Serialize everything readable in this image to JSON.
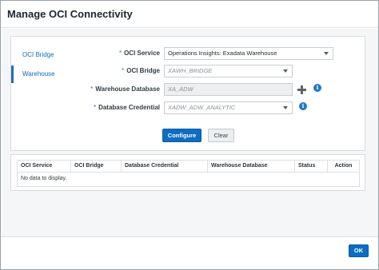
{
  "dialog": {
    "title": "Manage OCI Connectivity"
  },
  "nav": {
    "items": [
      {
        "label": "OCI Bridge"
      },
      {
        "label": "Warehouse"
      }
    ]
  },
  "form": {
    "required_mark": "*",
    "oci_service": {
      "label": "OCI Service",
      "value": "Operations Insights: Exadata Warehouse"
    },
    "oci_bridge": {
      "label": "OCI Bridge",
      "value": "XAWH_BRIDGE"
    },
    "warehouse_database": {
      "label": "Warehouse Database",
      "value": "XA_ADW"
    },
    "database_credential": {
      "label": "Database Credential",
      "value": "XADW_ADW_ANALYTIC"
    },
    "info_glyph": "i",
    "configure_label": "Configure",
    "clear_label": "Clear"
  },
  "table": {
    "columns": [
      "OCI Service",
      "OCI Bridge",
      "Database Credential",
      "Warehouse Database",
      "Status",
      "Action"
    ],
    "empty_text": "No data to display."
  },
  "footer": {
    "ok_label": "OK"
  },
  "colors": {
    "accent": "#0e6cc3",
    "info": "#1f78c8",
    "panel_bg": "#f5f6f7"
  },
  "icons": [
    "caret-down-icon",
    "plus-icon",
    "info-icon"
  ]
}
